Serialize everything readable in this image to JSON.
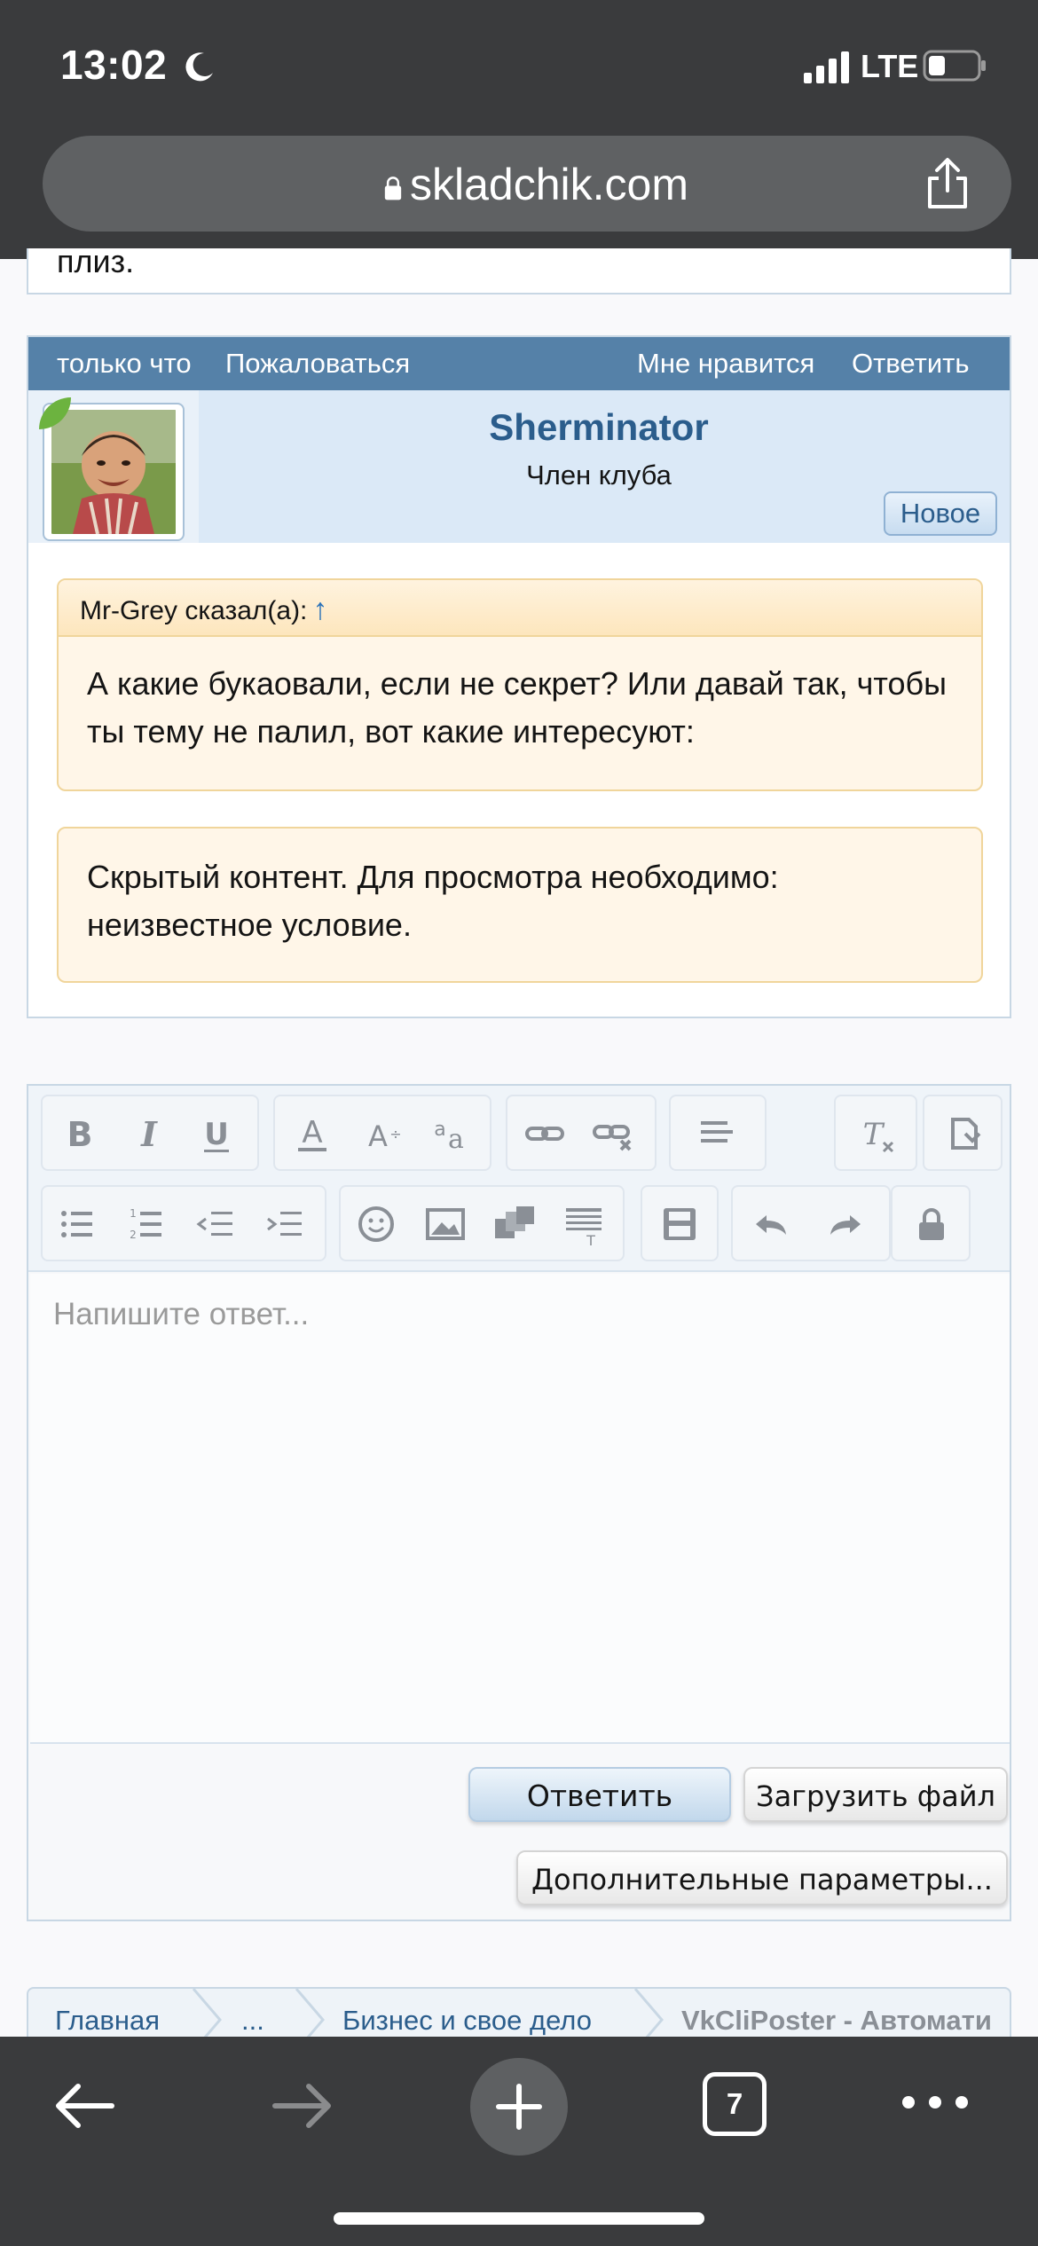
{
  "status_bar": {
    "time": "13:02",
    "network": "LTE"
  },
  "browser": {
    "url": "skladchik.com",
    "tab_count": "7"
  },
  "prev_post": {
    "text": "плиз."
  },
  "post": {
    "timestamp": "только что",
    "report_link": "Пожаловаться",
    "like_link": "Мне нравится",
    "reply_link": "Ответить",
    "author": {
      "name": "Sherminator",
      "role": "Член клуба",
      "badge": "Новое"
    },
    "quote": {
      "header": "Mr-Grey сказал(а):",
      "arrow": "↑",
      "text": "А какие букаовали, если не секрет? Или давай так, чтобы ты тему не палил, вот какие интересуют:"
    },
    "hidden_content": "Скрытый контент. Для просмотра необходимо: неизвестное условие."
  },
  "editor": {
    "placeholder": "Напишите ответ...",
    "reply_button": "Ответить",
    "upload_button": "Загрузить файл",
    "more_options_button": "Дополнительные параметры..."
  },
  "breadcrumb": {
    "items": [
      "Главная",
      "...",
      "Бизнес и свое дело"
    ],
    "current": "VkCliPoster - Автомати"
  },
  "colors": {
    "header_bar": "#5581a8",
    "author_bg": "#dbe9f7",
    "quote_bg": "#fff6e8",
    "link": "#2b5d8c",
    "chrome": "#3a3b3d"
  },
  "icons": {
    "toolbar_row1": [
      "bold-icon",
      "italic-icon",
      "underline-icon",
      "font-color-icon",
      "font-size-icon",
      "font-family-icon",
      "link-icon",
      "unlink-icon",
      "align-icon",
      "remove-format-icon",
      "bbcode-toggle-icon"
    ],
    "toolbar_row2": [
      "bullet-list-icon",
      "numbered-list-icon",
      "outdent-icon",
      "indent-icon",
      "smiley-icon",
      "image-icon",
      "media-icon",
      "insert-quote-icon",
      "save-draft-icon",
      "undo-icon",
      "redo-icon",
      "lock-icon"
    ]
  }
}
